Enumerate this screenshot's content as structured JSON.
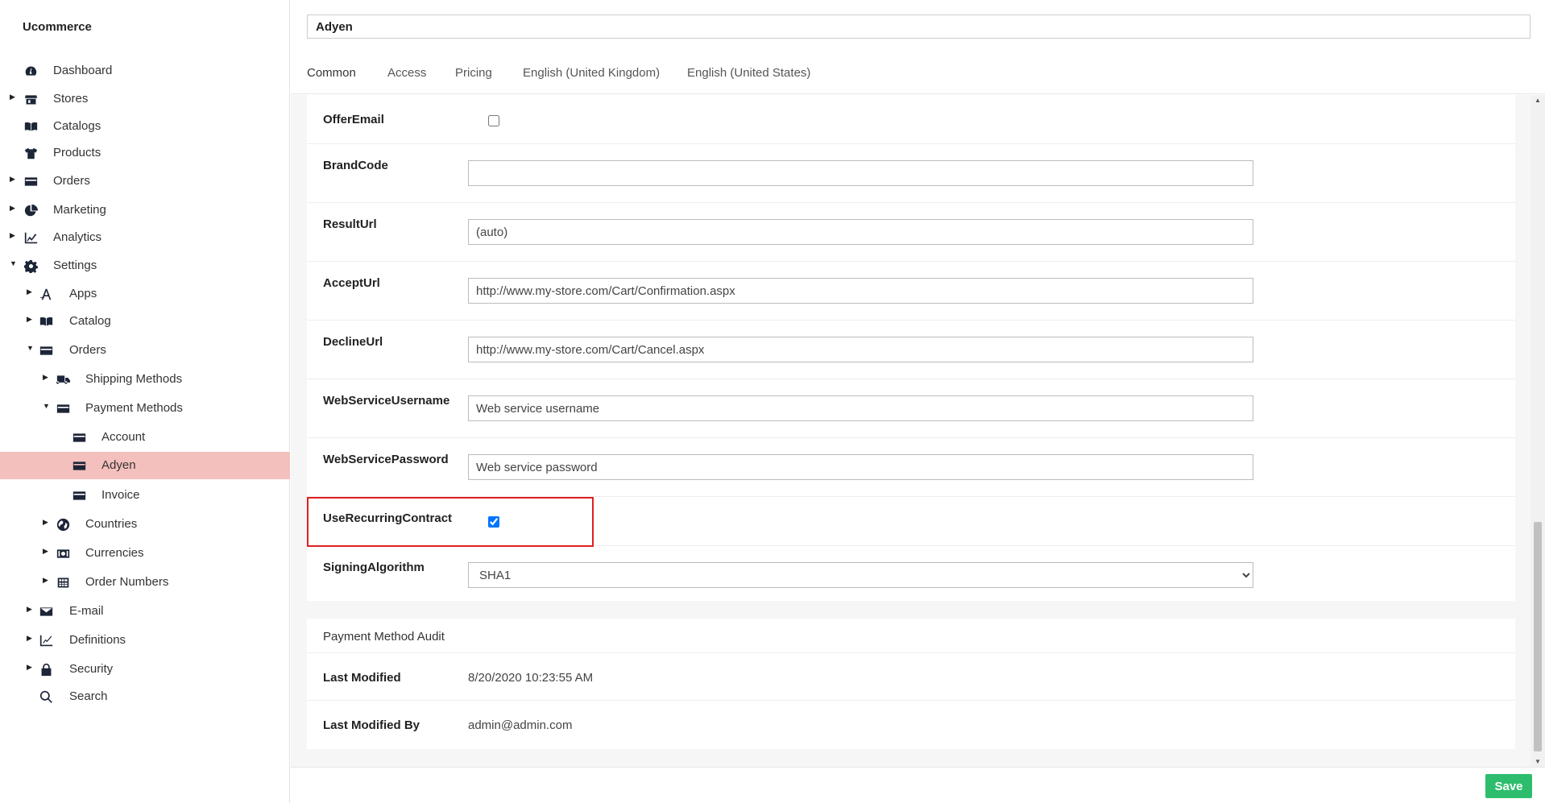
{
  "sidebar": {
    "brand": "Ucommerce",
    "items": [
      {
        "label": "Dashboard"
      },
      {
        "label": "Stores"
      },
      {
        "label": "Catalogs"
      },
      {
        "label": "Products"
      },
      {
        "label": "Orders"
      },
      {
        "label": "Marketing"
      },
      {
        "label": "Analytics"
      },
      {
        "label": "Settings"
      },
      {
        "label": "Apps"
      },
      {
        "label": "Catalog"
      },
      {
        "label": "Orders"
      },
      {
        "label": "Shipping Methods"
      },
      {
        "label": "Payment Methods"
      },
      {
        "label": "Account"
      },
      {
        "label": "Adyen"
      },
      {
        "label": "Invoice"
      },
      {
        "label": "Countries"
      },
      {
        "label": "Currencies"
      },
      {
        "label": "Order Numbers"
      },
      {
        "label": "E-mail"
      },
      {
        "label": "Definitions"
      },
      {
        "label": "Security"
      },
      {
        "label": "Search"
      }
    ]
  },
  "header": {
    "name_value": "Adyen"
  },
  "tabs": [
    {
      "label": "Common"
    },
    {
      "label": "Access"
    },
    {
      "label": "Pricing"
    },
    {
      "label": "English (United Kingdom)"
    },
    {
      "label": "English (United States)"
    }
  ],
  "form": {
    "offer_email": {
      "label": "OfferEmail",
      "checked": false
    },
    "brand_code": {
      "label": "BrandCode",
      "value": ""
    },
    "result_url": {
      "label": "ResultUrl",
      "value": "(auto)"
    },
    "accept_url": {
      "label": "AcceptUrl",
      "value": "http://www.my-store.com/Cart/Confirmation.aspx"
    },
    "decline_url": {
      "label": "DeclineUrl",
      "value": "http://www.my-store.com/Cart/Cancel.aspx"
    },
    "ws_username": {
      "label": "WebServiceUsername",
      "value": "Web service username"
    },
    "ws_password": {
      "label": "WebServicePassword",
      "value": "Web service password"
    },
    "use_recurring": {
      "label": "UseRecurringContract",
      "checked": true
    },
    "signing_algorithm": {
      "label": "SigningAlgorithm",
      "value": "SHA1"
    }
  },
  "audit": {
    "title": "Payment Method Audit",
    "last_modified_label": "Last Modified",
    "last_modified_value": "8/20/2020 10:23:55 AM",
    "last_modified_by_label": "Last Modified By",
    "last_modified_by_value": "admin@admin.com"
  },
  "footer": {
    "save_label": "Save"
  },
  "colors": {
    "accent": "#f4c0bd",
    "save": "#2ebd6d",
    "highlight": "#e02020"
  }
}
